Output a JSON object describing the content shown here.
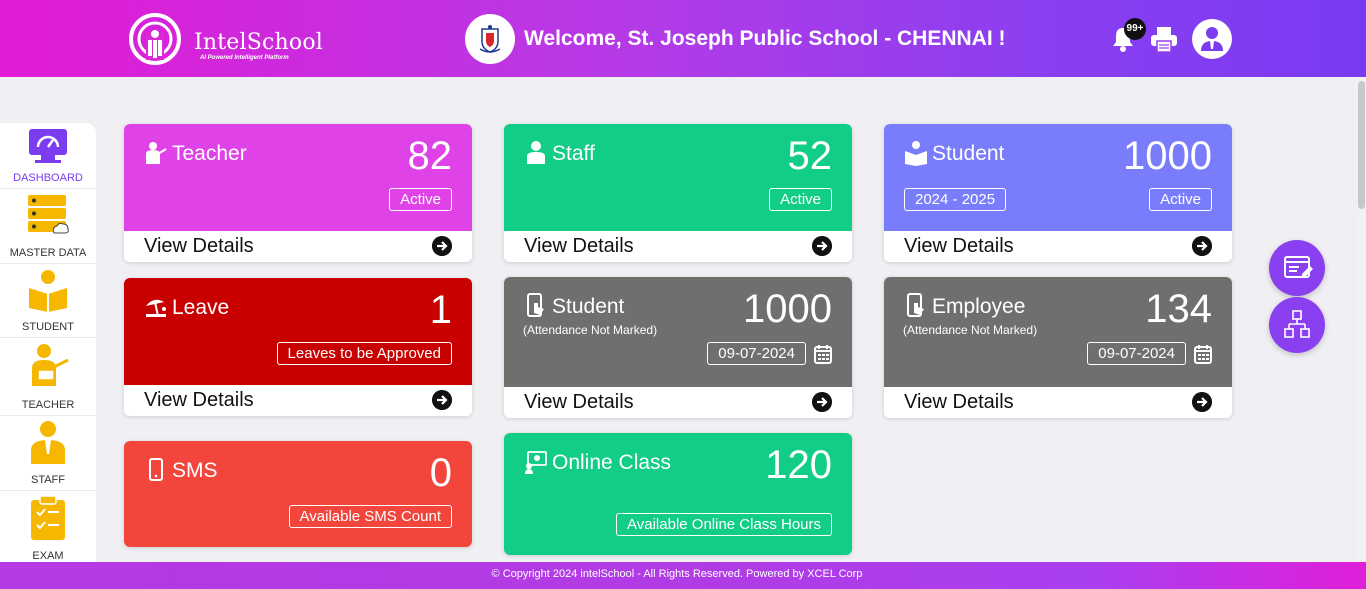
{
  "header": {
    "logo_text": "IntelSchool",
    "logo_tagline": "AI Powered Intelligent Platform",
    "welcome": "Welcome, St. Joseph Public School - CHENNAI !",
    "notification_count": "99+"
  },
  "sidebar": {
    "items": [
      {
        "label": "DASHBOARD",
        "icon": "dashboard-icon",
        "active": true
      },
      {
        "label": "MASTER DATA",
        "icon": "server-icon"
      },
      {
        "label": "STUDENT",
        "icon": "student-reading-icon"
      },
      {
        "label": "TEACHER",
        "icon": "teacher-icon"
      },
      {
        "label": "STAFF",
        "icon": "staff-icon"
      },
      {
        "label": "EXAM",
        "icon": "clipboard-checklist-icon"
      }
    ]
  },
  "cards": {
    "teacher": {
      "title": "Teacher",
      "count": "82",
      "status": "Active",
      "link": "View Details",
      "color": "#df43e8"
    },
    "staff": {
      "title": "Staff",
      "count": "52",
      "status": "Active",
      "link": "View Details",
      "color": "#12cd85"
    },
    "student": {
      "title": "Student",
      "count": "1000",
      "year": "2024 - 2025",
      "status": "Active",
      "link": "View Details",
      "color": "#7a7dfb"
    },
    "leave": {
      "title": "Leave",
      "count": "1",
      "status": "Leaves to be Approved",
      "link": "View Details",
      "color": "#c90000"
    },
    "student_att": {
      "title": "Student",
      "subtitle": "(Attendance Not Marked)",
      "count": "1000",
      "date": "09-07-2024",
      "link": "View Details",
      "color": "#716e6e"
    },
    "employee_att": {
      "title": "Employee",
      "subtitle": "(Attendance Not Marked)",
      "count": "134",
      "date": "09-07-2024",
      "link": "View Details",
      "color": "#716e6e"
    },
    "sms": {
      "title": "SMS",
      "count": "0",
      "status": "Available SMS Count",
      "color": "#f2453b"
    },
    "online_class": {
      "title": "Online Class",
      "count": "120",
      "status": "Available Online Class Hours",
      "color": "#12cd85"
    }
  },
  "footer": {
    "text": "© Copyright 2024 intelSchool - All Rights Reserved. Powered by XCEL Corp"
  },
  "accent_color": "#8a3ff0"
}
